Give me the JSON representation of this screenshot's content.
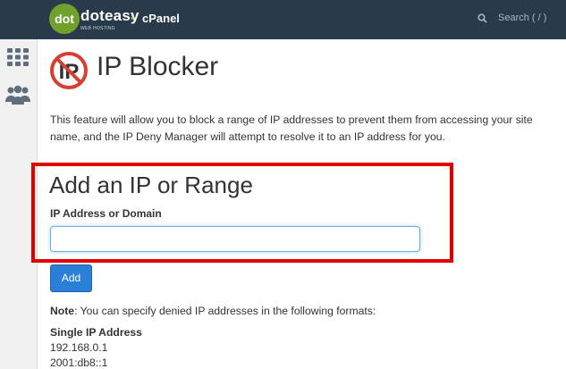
{
  "header": {
    "logo_text": "doteasy",
    "logo_sub": "WEB HOSTING",
    "separator": "•",
    "app_name": "cPanel",
    "search_placeholder": "Search ( / )"
  },
  "sidebar": {
    "items": [
      {
        "icon": "grid-icon"
      },
      {
        "icon": "users-icon"
      }
    ]
  },
  "page": {
    "title": "IP Blocker",
    "description_line1": "This feature will allow you to block a range of IP addresses to prevent them from accessing your site",
    "description_line2": "name, and the IP Deny Manager will attempt to resolve it to an IP address for you."
  },
  "form": {
    "section_title": "Add an IP or Range",
    "field_label": "IP Address or Domain",
    "field_value": "",
    "add_label": "Add"
  },
  "notes": {
    "note_label": "Note",
    "note_text": ": You can specify denied IP addresses in the following formats:",
    "single_heading": "Single IP Address",
    "example1": "192.168.0.1",
    "example2": "2001:db8::1"
  },
  "colors": {
    "topbar": "#293a4a",
    "brand_green": "#6fa12c",
    "highlight": "#e00000",
    "button": "#2a80d6"
  }
}
